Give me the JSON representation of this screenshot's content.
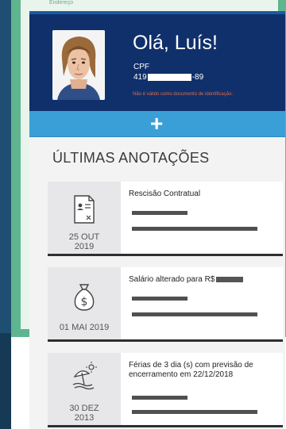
{
  "background": {
    "partial_text": "Endereço"
  },
  "profile": {
    "greeting": "Olá, Luís!",
    "cpf_label": "CPF",
    "cpf_prefix": "419",
    "cpf_suffix": "-89",
    "warning": "Não é válido como documento de identificação."
  },
  "add_button": {
    "label": "+"
  },
  "section": {
    "title": "ÚLTIMAS ANOTAÇÕES"
  },
  "entries": [
    {
      "title": "Rescisão Contratual",
      "date_line1": "25 OUT",
      "date_line2": "2019",
      "icon": "contract-icon"
    },
    {
      "title": "Salário alterado para R$",
      "date_line1": "01 MAI 2019",
      "date_line2": "",
      "icon": "money-bag-icon"
    },
    {
      "title": "Férias de 3 dia (s) com previsão de encerramento em 22/12/2018",
      "date_line1": "30 DEZ",
      "date_line2": "2013",
      "icon": "beach-icon"
    }
  ],
  "colors": {
    "header": "#10306c",
    "add_bar": "#3a9fd6",
    "warning": "#e46b42"
  }
}
